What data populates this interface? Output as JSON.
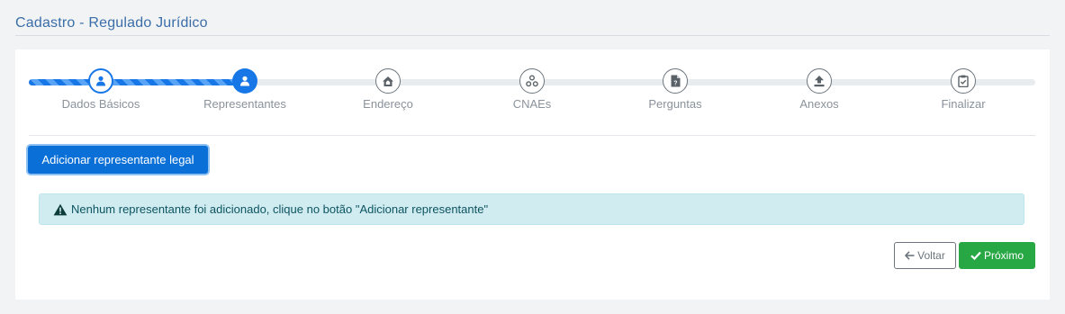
{
  "page": {
    "title": "Cadastro - Regulado Jurídico"
  },
  "stepper": {
    "steps": [
      {
        "label": "Dados Básicos",
        "icon": "user-icon",
        "state": "done"
      },
      {
        "label": "Representantes",
        "icon": "user-icon",
        "state": "active"
      },
      {
        "label": "Endereço",
        "icon": "home-icon",
        "state": "pending"
      },
      {
        "label": "CNAEs",
        "icon": "sitemap-icon",
        "state": "pending"
      },
      {
        "label": "Perguntas",
        "icon": "file-question-icon",
        "state": "pending"
      },
      {
        "label": "Anexos",
        "icon": "upload-icon",
        "state": "pending"
      },
      {
        "label": "Finalizar",
        "icon": "clipboard-check-icon",
        "state": "pending"
      }
    ]
  },
  "actions": {
    "add_label": "Adicionar representante legal"
  },
  "alert": {
    "icon": "warning-icon",
    "text": "Nenhum representante foi adicionado, clique no botão \"Adicionar representante\""
  },
  "nav": {
    "back_label": "Voltar",
    "next_label": "Próximo"
  },
  "colors": {
    "primary": "#1877e6",
    "success": "#28a745",
    "info_bg": "#d1ecf1",
    "title": "#3a6ea8"
  }
}
